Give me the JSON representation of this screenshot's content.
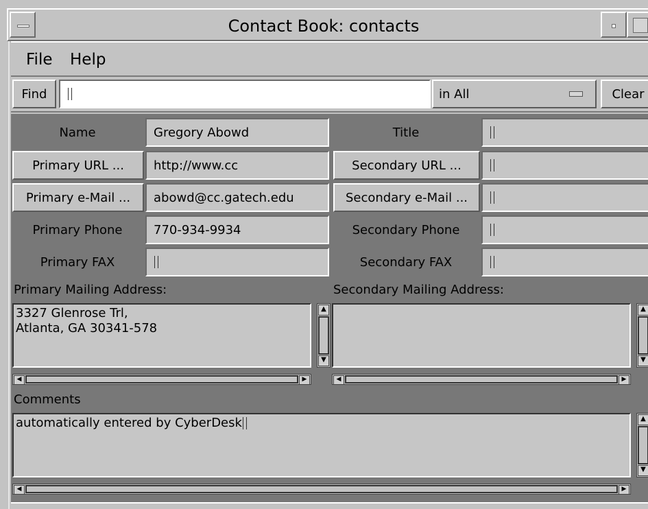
{
  "window": {
    "title": "Contact Book: contacts"
  },
  "menu": {
    "items": [
      "File",
      "Help"
    ]
  },
  "search": {
    "find_label": "Find",
    "query": "",
    "scope": "in All",
    "clear_label": "Clear"
  },
  "fields": {
    "name_label": "Name",
    "name_value": "Gregory Abowd",
    "title_label": "Title",
    "title_value": "",
    "primary_url_label": "Primary URL ...",
    "primary_url_value": "http://www.cc",
    "secondary_url_label": "Secondary URL ...",
    "secondary_url_value": "",
    "primary_email_label": "Primary e-Mail ...",
    "primary_email_value": "abowd@cc.gatech.edu",
    "secondary_email_label": "Secondary e-Mail ...",
    "secondary_email_value": "",
    "primary_phone_label": "Primary Phone",
    "primary_phone_value": "770-934-9934",
    "secondary_phone_label": "Secondary Phone",
    "secondary_phone_value": "",
    "primary_fax_label": "Primary FAX",
    "primary_fax_value": "",
    "secondary_fax_label": "Secondary FAX",
    "secondary_fax_value": ""
  },
  "addresses": {
    "primary_label": "Primary Mailing Address:",
    "primary_value": "3327 Glenrose Trl,\nAtlanta, GA 30341-578",
    "secondary_label": "Secondary Mailing Address:",
    "secondary_value": ""
  },
  "comments": {
    "label": "Comments",
    "value": "automatically entered by CyberDesk"
  },
  "icons": {
    "window_menu": "window-menu-icon",
    "minimize": "minimize-icon",
    "maximize": "maximize-icon",
    "scroll_up": "scroll-up-arrow-icon",
    "scroll_down": "scroll-down-arrow-icon",
    "scroll_left": "scroll-left-arrow-icon",
    "scroll_right": "scroll-right-arrow-icon",
    "dropdown": "dropdown-indicator-icon"
  }
}
